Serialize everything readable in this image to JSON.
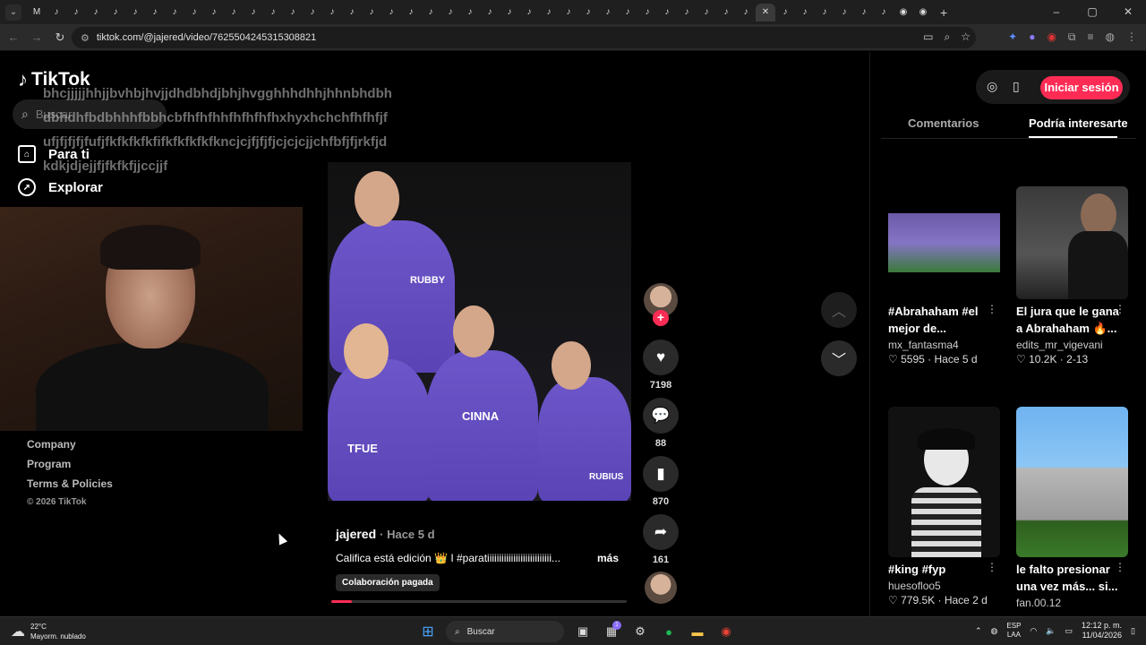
{
  "browser": {
    "tab_count": 46,
    "url": "tiktok.com/@jajered/video/7625504245315308821",
    "window_controls": [
      "–",
      "▢",
      "✕"
    ]
  },
  "typed_overlay": "bhcjjjjjhhjjbvhbjhvjjdhdbhdjbhjhvgghhhdhhjhhnbhdbhdbhdhfbdbhhhfbbhcbfhfhfhhfhfhfhfhxhyxhchchfhfhfjfufjfjfjfjfufjfkfkfkfkfifkfkfkfkfkncjcjfjfjfjcjcjcjjchfbfjfjrkfjdkdkjdjejjfjfkfkfjjccjjf",
  "sidebar": {
    "logo": "TikTok",
    "search_placeholder": "Buscar",
    "nav": [
      {
        "label": "Para ti",
        "icon": "home-icon"
      },
      {
        "label": "Explorar",
        "icon": "compass-icon"
      }
    ],
    "footer": [
      "Company",
      "Program",
      "Terms & Policies"
    ],
    "copyright": "© 2026 TikTok"
  },
  "video": {
    "author": "jajered",
    "posted": "· Hace 5 d",
    "caption": "Califica está edición 👑 I #paratiiiiiiiiiiiiiiiiiiiiiiiiiii...",
    "more": "más",
    "badge": "Colaboración pagada",
    "progress": 0.07,
    "jersey_texts": [
      "RUBBY",
      "CINNA",
      "TFUE",
      "RUBIUS"
    ]
  },
  "actions": {
    "follow": "+",
    "likes": "7198",
    "comments": "88",
    "saves": "870",
    "shares": "161"
  },
  "right_panel": {
    "login": "Iniciar sesión",
    "tab_comments": "Comentarios",
    "tab_suggested": "Podría interesarte",
    "cards": [
      {
        "title": "#Abrahaham #el mejor de...",
        "author": "mx_fantasma4",
        "likes": "5595",
        "time": "Hace 5 d"
      },
      {
        "title": "El jura que le gana a Abrahaham 🔥...",
        "author": "edits_mr_vigevani",
        "likes": "10.2K",
        "time": "2-13"
      },
      {
        "title": "#king #fyp",
        "author": "huesofloo5",
        "likes": "779.5K",
        "time": "Hace 2 d"
      },
      {
        "title": "le falto presionar una vez más... si...",
        "author": "fan.00.12",
        "likes": "",
        "time": ""
      }
    ]
  },
  "taskbar": {
    "temp": "22°C",
    "weather": "Mayorm. nublado",
    "search": "Buscar",
    "lang1": "ESP",
    "lang2": "LAA",
    "time": "12:12 p. m.",
    "date": "11/04/2026",
    "badge": "1"
  }
}
